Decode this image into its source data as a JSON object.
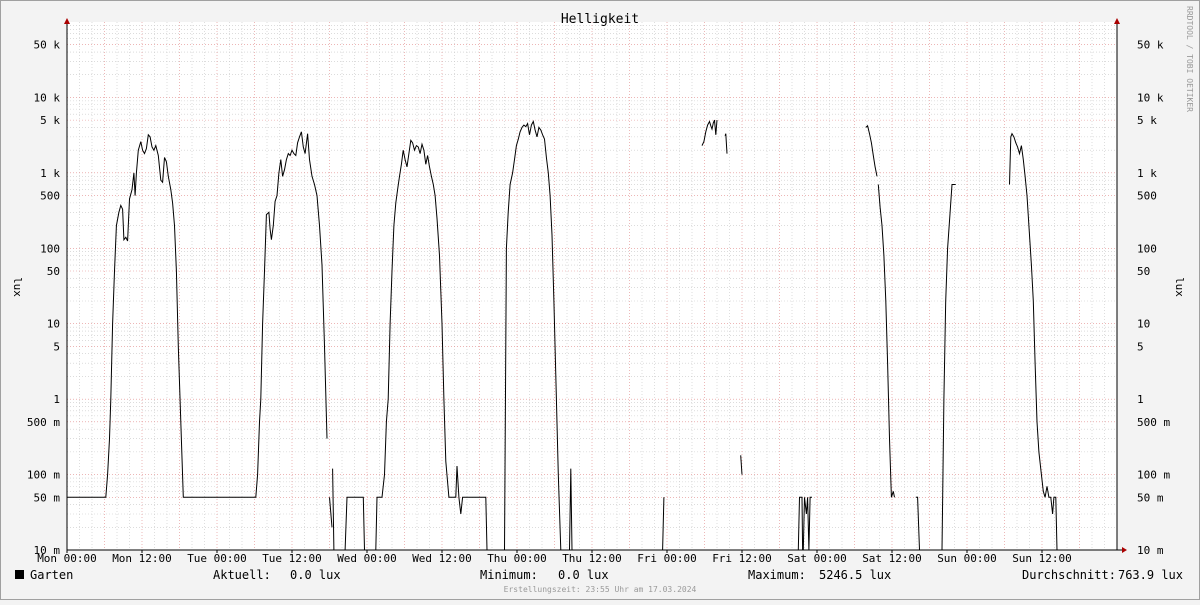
{
  "window": {
    "frame_color": "#a0a0a0",
    "background": "#f3f3f3",
    "plot_background": "#ffffff"
  },
  "chart_data": {
    "type": "line",
    "title": "Helligkeit",
    "ylabel": "lux",
    "yscale": "log",
    "ylim": [
      0.01,
      100000
    ],
    "xlim": [
      0,
      168
    ],
    "grid": true,
    "colors": {
      "major_grid": "#e28a8a",
      "minor_grid": "#c8c8c8",
      "line": "#000000",
      "arrow": "#aa0000"
    },
    "x_ticks": [
      {
        "label": "Mon 00:00",
        "x": 0
      },
      {
        "label": "Mon 12:00",
        "x": 12
      },
      {
        "label": "Tue 00:00",
        "x": 24
      },
      {
        "label": "Tue 12:00",
        "x": 36
      },
      {
        "label": "Wed 00:00",
        "x": 48
      },
      {
        "label": "Wed 12:00",
        "x": 60
      },
      {
        "label": "Thu 00:00",
        "x": 72
      },
      {
        "label": "Thu 12:00",
        "x": 84
      },
      {
        "label": "Fri 00:00",
        "x": 96
      },
      {
        "label": "Fri 12:00",
        "x": 108
      },
      {
        "label": "Sat 00:00",
        "x": 120
      },
      {
        "label": "Sat 12:00",
        "x": 132
      },
      {
        "label": "Sun 00:00",
        "x": 144
      },
      {
        "label": "Sun 12:00",
        "x": 156
      }
    ],
    "y_ticks": [
      {
        "label": "10 m",
        "v": 0.01
      },
      {
        "label": "50 m",
        "v": 0.05
      },
      {
        "label": "100 m",
        "v": 0.1
      },
      {
        "label": "500 m",
        "v": 0.5
      },
      {
        "label": "1",
        "v": 1
      },
      {
        "label": "5",
        "v": 5
      },
      {
        "label": "10",
        "v": 10
      },
      {
        "label": "50",
        "v": 50
      },
      {
        "label": "100",
        "v": 100
      },
      {
        "label": "500",
        "v": 500
      },
      {
        "label": "1 k",
        "v": 1000
      },
      {
        "label": "5 k",
        "v": 5000
      },
      {
        "label": "10 k",
        "v": 10000
      },
      {
        "label": "50 k",
        "v": 50000
      }
    ],
    "series": [
      {
        "color": "#000000",
        "segments": [
          [
            [
              0,
              0.05
            ],
            [
              6.2,
              0.05
            ],
            [
              6.5,
              0.1
            ],
            [
              6.8,
              0.3
            ],
            [
              7.0,
              1
            ],
            [
              7.3,
              10
            ],
            [
              7.6,
              50
            ],
            [
              7.9,
              200
            ],
            [
              8.3,
              300
            ],
            [
              8.6,
              370
            ],
            [
              8.9,
              330
            ],
            [
              9.1,
              130
            ],
            [
              9.4,
              140
            ],
            [
              9.7,
              125
            ],
            [
              10.0,
              450
            ],
            [
              10.4,
              600
            ],
            [
              10.7,
              1000
            ],
            [
              10.9,
              500
            ],
            [
              11.1,
              1000
            ],
            [
              11.4,
              2000
            ],
            [
              11.8,
              2600
            ],
            [
              12.1,
              2000
            ],
            [
              12.4,
              1800
            ],
            [
              12.7,
              2100
            ],
            [
              13.0,
              3200
            ],
            [
              13.3,
              3000
            ],
            [
              13.6,
              2200
            ],
            [
              13.9,
              2000
            ],
            [
              14.2,
              2300
            ],
            [
              14.6,
              1700
            ],
            [
              15.0,
              800
            ],
            [
              15.3,
              750
            ],
            [
              15.6,
              1600
            ],
            [
              15.9,
              1400
            ],
            [
              16.2,
              900
            ],
            [
              16.6,
              600
            ],
            [
              16.9,
              400
            ],
            [
              17.2,
              200
            ],
            [
              17.5,
              50
            ],
            [
              17.8,
              5
            ],
            [
              18.2,
              0.5
            ],
            [
              18.6,
              0.05
            ],
            [
              24,
              0.05
            ],
            [
              30.2,
              0.05
            ],
            [
              30.5,
              0.1
            ],
            [
              30.8,
              0.5
            ],
            [
              31.0,
              1
            ],
            [
              31.3,
              10
            ],
            [
              31.6,
              50
            ],
            [
              31.9,
              280
            ],
            [
              32.3,
              300
            ],
            [
              32.5,
              180
            ],
            [
              32.7,
              130
            ],
            [
              33.0,
              200
            ],
            [
              33.3,
              420
            ],
            [
              33.6,
              500
            ],
            [
              33.9,
              1000
            ],
            [
              34.2,
              1500
            ],
            [
              34.5,
              900
            ],
            [
              34.8,
              1100
            ],
            [
              35.1,
              1500
            ],
            [
              35.4,
              1800
            ],
            [
              35.7,
              1700
            ],
            [
              36.0,
              2000
            ],
            [
              36.3,
              1800
            ],
            [
              36.6,
              1700
            ],
            [
              36.9,
              2500
            ],
            [
              37.2,
              3000
            ],
            [
              37.5,
              3500
            ],
            [
              37.8,
              2200
            ],
            [
              38.1,
              1800
            ],
            [
              38.5,
              3300
            ],
            [
              38.8,
              1500
            ],
            [
              39.2,
              900
            ],
            [
              39.6,
              700
            ],
            [
              40.0,
              500
            ],
            [
              40.4,
              200
            ],
            [
              40.8,
              60
            ],
            [
              41.2,
              5
            ],
            [
              41.6,
              0.3
            ]
          ],
          [
            [
              42.0,
              0.05
            ],
            [
              42.4,
              0.02
            ]
          ],
          [
            [
              42.5,
              0.12
            ],
            [
              42.7,
              0.01
            ]
          ],
          [
            [
              44.5,
              0.01
            ],
            [
              44.8,
              0.05
            ],
            [
              47.4,
              0.05
            ],
            [
              47.6,
              0.01
            ]
          ],
          [
            [
              49.4,
              0.01
            ],
            [
              49.6,
              0.05
            ],
            [
              50.4,
              0.05
            ],
            [
              50.8,
              0.1
            ],
            [
              51.1,
              0.5
            ],
            [
              51.4,
              1
            ],
            [
              51.7,
              10
            ],
            [
              52.0,
              50
            ],
            [
              52.3,
              200
            ],
            [
              52.6,
              400
            ],
            [
              52.9,
              600
            ],
            [
              53.2,
              900
            ],
            [
              53.5,
              1300
            ],
            [
              53.8,
              2000
            ],
            [
              54.1,
              1500
            ],
            [
              54.4,
              1200
            ],
            [
              54.7,
              1800
            ],
            [
              55.0,
              2700
            ],
            [
              55.3,
              2500
            ],
            [
              55.6,
              2000
            ],
            [
              55.9,
              2300
            ],
            [
              56.2,
              2200
            ],
            [
              56.5,
              1800
            ],
            [
              56.8,
              2400
            ],
            [
              57.1,
              2000
            ],
            [
              57.4,
              1300
            ],
            [
              57.7,
              1700
            ],
            [
              58.0,
              1200
            ],
            [
              58.3,
              900
            ],
            [
              58.6,
              700
            ],
            [
              58.9,
              500
            ],
            [
              59.2,
              250
            ],
            [
              59.6,
              80
            ],
            [
              60.0,
              10
            ],
            [
              60.3,
              1
            ],
            [
              60.6,
              0.15
            ],
            [
              61.1,
              0.05
            ],
            [
              62.2,
              0.05
            ],
            [
              62.4,
              0.13
            ],
            [
              62.7,
              0.05
            ],
            [
              63.0,
              0.03
            ],
            [
              63.3,
              0.05
            ],
            [
              67.0,
              0.05
            ],
            [
              67.2,
              0.01
            ]
          ],
          [
            [
              70.0,
              0.01
            ],
            [
              70.3,
              100
            ],
            [
              70.6,
              300
            ],
            [
              70.9,
              700
            ],
            [
              71.3,
              1000
            ],
            [
              71.6,
              1500
            ],
            [
              71.9,
              2300
            ],
            [
              72.2,
              2800
            ],
            [
              72.5,
              3500
            ],
            [
              72.8,
              4000
            ],
            [
              73.1,
              4300
            ],
            [
              73.4,
              4100
            ],
            [
              73.7,
              4500
            ],
            [
              74.0,
              3200
            ],
            [
              74.3,
              4300
            ],
            [
              74.6,
              4800
            ],
            [
              74.9,
              3700
            ],
            [
              75.2,
              3000
            ],
            [
              75.5,
              4000
            ],
            [
              75.8,
              3700
            ],
            [
              76.1,
              3200
            ],
            [
              76.4,
              2800
            ],
            [
              76.7,
              1600
            ],
            [
              77.0,
              1000
            ],
            [
              77.3,
              500
            ],
            [
              77.6,
              150
            ],
            [
              77.9,
              20
            ],
            [
              78.3,
              1
            ],
            [
              78.6,
              0.1
            ],
            [
              79.0,
              0.01
            ]
          ],
          [
            [
              80.4,
              0.01
            ],
            [
              80.6,
              0.12
            ],
            [
              80.8,
              0.01
            ]
          ],
          [
            [
              95.3,
              0.01
            ],
            [
              95.5,
              0.05
            ]
          ],
          [
            [
              101.6,
              2300
            ],
            [
              101.9,
              2600
            ],
            [
              102.2,
              3500
            ],
            [
              102.5,
              4300
            ],
            [
              102.8,
              4800
            ],
            [
              103.0,
              4200
            ],
            [
              103.2,
              3800
            ],
            [
              103.4,
              4600
            ],
            [
              103.6,
              5000
            ],
            [
              103.8,
              3200
            ],
            [
              104.0,
              5000
            ]
          ],
          [
            [
              105.3,
              3100
            ],
            [
              105.4,
              3300
            ],
            [
              105.6,
              1800
            ]
          ],
          [
            [
              107.8,
              0.18
            ],
            [
              108.0,
              0.1
            ]
          ],
          [
            [
              117.0,
              0.01
            ],
            [
              117.2,
              0.05
            ],
            [
              117.6,
              0.05
            ],
            [
              117.7,
              0.01
            ]
          ],
          [
            [
              117.8,
              0.01
            ],
            [
              118.0,
              0.05
            ],
            [
              118.3,
              0.03
            ],
            [
              118.5,
              0.05
            ],
            [
              118.7,
              0.01
            ],
            [
              118.9,
              0.05
            ],
            [
              119.2,
              0.05
            ]
          ],
          [
            [
              127.8,
              4000
            ],
            [
              128.1,
              4200
            ],
            [
              128.4,
              3300
            ],
            [
              128.7,
              2500
            ],
            [
              129.0,
              1700
            ],
            [
              129.3,
              1200
            ],
            [
              129.6,
              900
            ]
          ],
          [
            [
              129.8,
              700
            ],
            [
              130.1,
              350
            ],
            [
              130.4,
              200
            ],
            [
              130.7,
              80
            ],
            [
              131.0,
              20
            ],
            [
              131.3,
              3
            ],
            [
              131.6,
              0.3
            ],
            [
              131.9,
              0.05
            ],
            [
              132.2,
              0.06
            ],
            [
              132.4,
              0.05
            ]
          ],
          [
            [
              135.8,
              0.05
            ],
            [
              136.1,
              0.05
            ],
            [
              136.4,
              0.01
            ]
          ],
          [
            [
              140.0,
              0.01
            ],
            [
              140.3,
              1
            ],
            [
              140.6,
              20
            ],
            [
              140.9,
              100
            ],
            [
              141.3,
              300
            ],
            [
              141.6,
              700
            ],
            [
              142.2,
              700
            ]
          ],
          [
            [
              150.8,
              700
            ],
            [
              151.0,
              3000
            ],
            [
              151.2,
              3300
            ],
            [
              151.5,
              3000
            ],
            [
              151.8,
              2500
            ],
            [
              152.1,
              2200
            ],
            [
              152.4,
              1800
            ],
            [
              152.7,
              2300
            ],
            [
              153.0,
              1500
            ],
            [
              153.3,
              900
            ],
            [
              153.6,
              500
            ],
            [
              153.9,
              200
            ],
            [
              154.3,
              60
            ],
            [
              154.6,
              20
            ],
            [
              154.9,
              3
            ],
            [
              155.2,
              0.5
            ],
            [
              155.5,
              0.2
            ],
            [
              155.9,
              0.1
            ],
            [
              156.2,
              0.06
            ],
            [
              156.5,
              0.05
            ],
            [
              156.8,
              0.07
            ],
            [
              157.1,
              0.05
            ],
            [
              157.4,
              0.05
            ],
            [
              157.7,
              0.03
            ],
            [
              157.9,
              0.05
            ],
            [
              158.2,
              0.05
            ],
            [
              158.4,
              0.01
            ]
          ]
        ]
      }
    ]
  },
  "legend": {
    "series_label": "Garten",
    "aktuell_label": "Aktuell:",
    "aktuell_value": "0.0 lux",
    "minimum_label": "Minimum:",
    "minimum_value": "0.0 lux",
    "maximum_label": "Maximum:",
    "maximum_value": "5246.5 lux",
    "avg_label": "Durchschnitt:",
    "avg_value": "763.9 lux"
  },
  "footer": "Erstellungszeit: 23:55 Uhr am 17.03.2024",
  "watermark": "RRDTOOL / TOBI OETIKER"
}
